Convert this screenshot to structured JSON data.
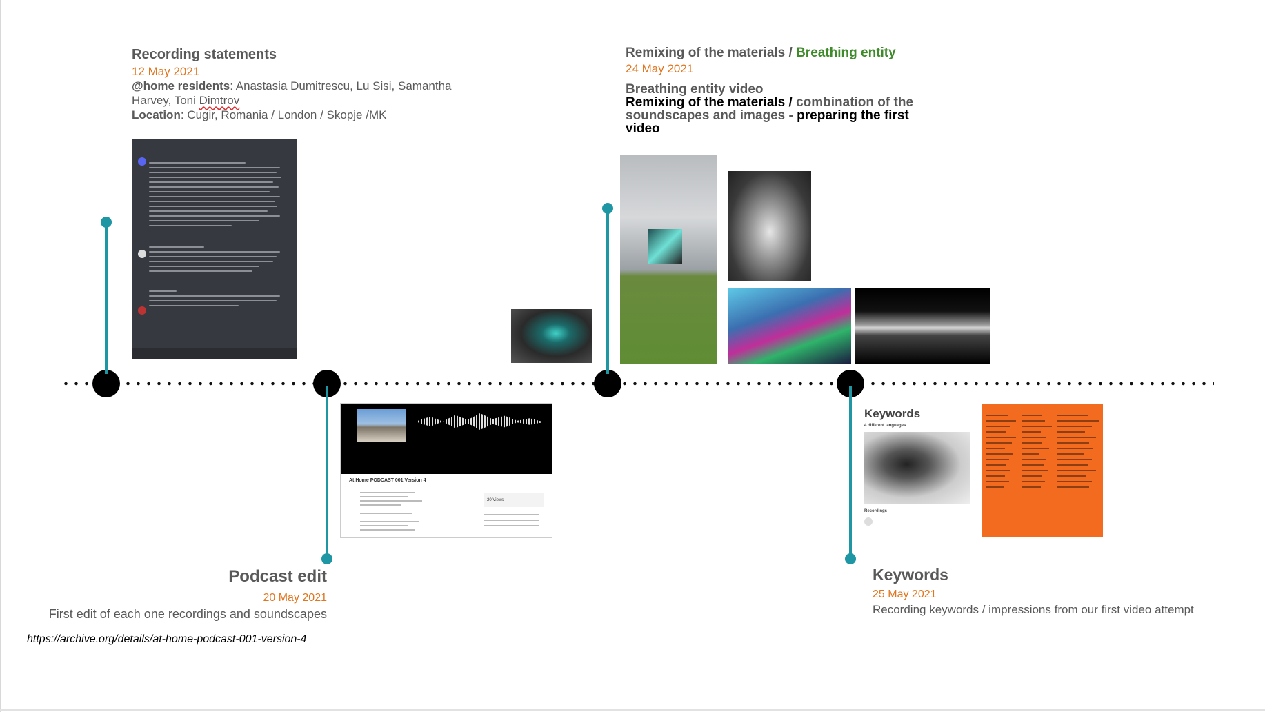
{
  "events": {
    "recording": {
      "title": "Recording statements",
      "date": "12 May 2021",
      "residents_label": "@home residents",
      "residents_line1": ": Anastasia Dumitrescu, Lu Sisi, Samantha",
      "residents_line2_a": "Harvey, Toni ",
      "residents_line2_b": "Dimtrov",
      "location_label": "Location",
      "location_value": ": Cugir, Romania / London / Skopje /MK"
    },
    "podcast": {
      "title": "Podcast edit",
      "date": "20  May 2021",
      "description": "First edit of each one recordings and soundscapes",
      "link": "https://archive.org/details/at-home-podcast-001-version-4",
      "player_title": "At Home PODCAST 001 Version 4",
      "views": "20 Views"
    },
    "remix": {
      "title_a": "Remixing of the materials / ",
      "title_b": "Breathing entity",
      "date": "24 May 2021",
      "video_title": "Breathing entity video",
      "line1_a": "Remixing of the materials / ",
      "line1_b": "combination of the",
      "line2_a": "soundscapes and images - ",
      "line2_b": "preparing the first",
      "line3": "video"
    },
    "keywords": {
      "title": "Keywords",
      "date": "25 May 2021",
      "description": "Recording keywords / impressions from our first video attempt",
      "card_title": "Keywords",
      "card_subtitle": "4 different languages",
      "card_recordings": "Recordings"
    }
  },
  "colors": {
    "teal": "#1e96a3",
    "orange_date": "#e0761f",
    "green": "#3f8a2b",
    "grey_text": "#595959"
  }
}
